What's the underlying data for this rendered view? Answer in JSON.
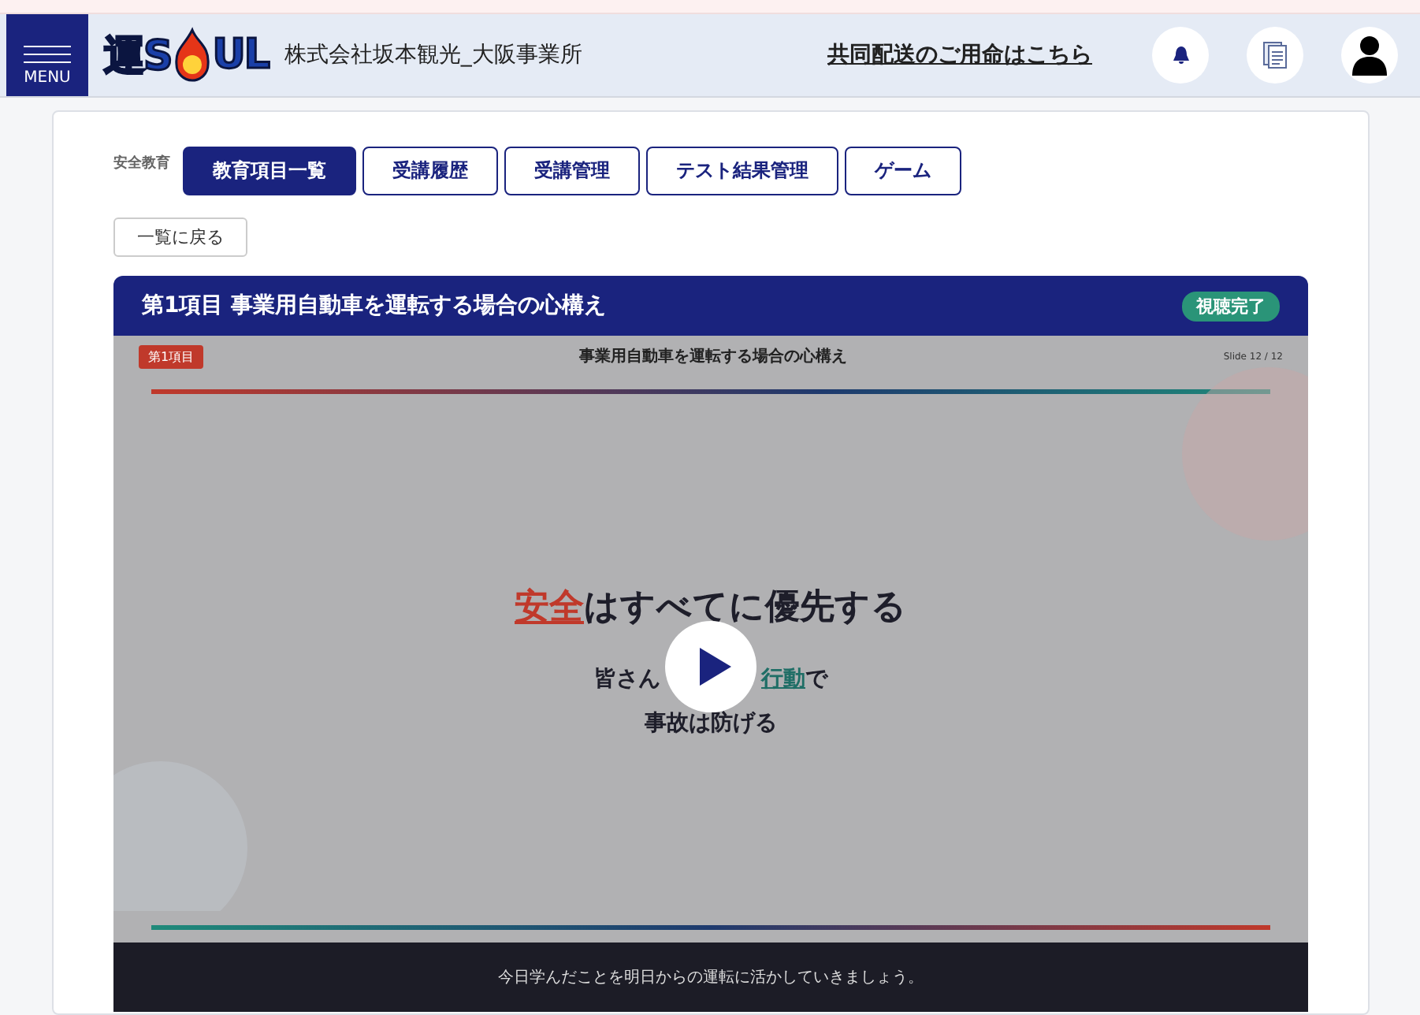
{
  "header": {
    "menu_label": "MENU",
    "logo": {
      "before": "運S",
      "after": "UL"
    },
    "company": "株式会社坂本観光_大阪事業所",
    "link": "共同配送のご用命はこちら"
  },
  "section_label": "安全教育",
  "tabs": [
    {
      "label": "教育項目一覧",
      "selected": true
    },
    {
      "label": "受講履歴",
      "selected": false
    },
    {
      "label": "受講管理",
      "selected": false
    },
    {
      "label": "テスト結果管理",
      "selected": false
    },
    {
      "label": "ゲーム",
      "selected": false
    }
  ],
  "back_button": "一覧に戻る",
  "lesson": {
    "title": "第1項目 事業用自動車を運転する場合の心構え",
    "status": "視聴完了",
    "completed": true,
    "slide": {
      "tag": "第1項目",
      "title": "事業用自動車を運転する場合の心構え",
      "counter": "Slide 12 / 12",
      "headline": [
        {
          "text": "安全",
          "kind": "red"
        },
        {
          "text": "はすべてに優先する",
          "kind": "plain"
        }
      ],
      "line_left": "皆さん",
      "line_right": [
        {
          "text": "行動",
          "kind": "teal"
        },
        {
          "text": "で",
          "kind": "plain"
        }
      ],
      "line_last": "事故は防げる"
    },
    "caption": "今日学んだことを明日からの運転に活かしていきましょう。"
  }
}
